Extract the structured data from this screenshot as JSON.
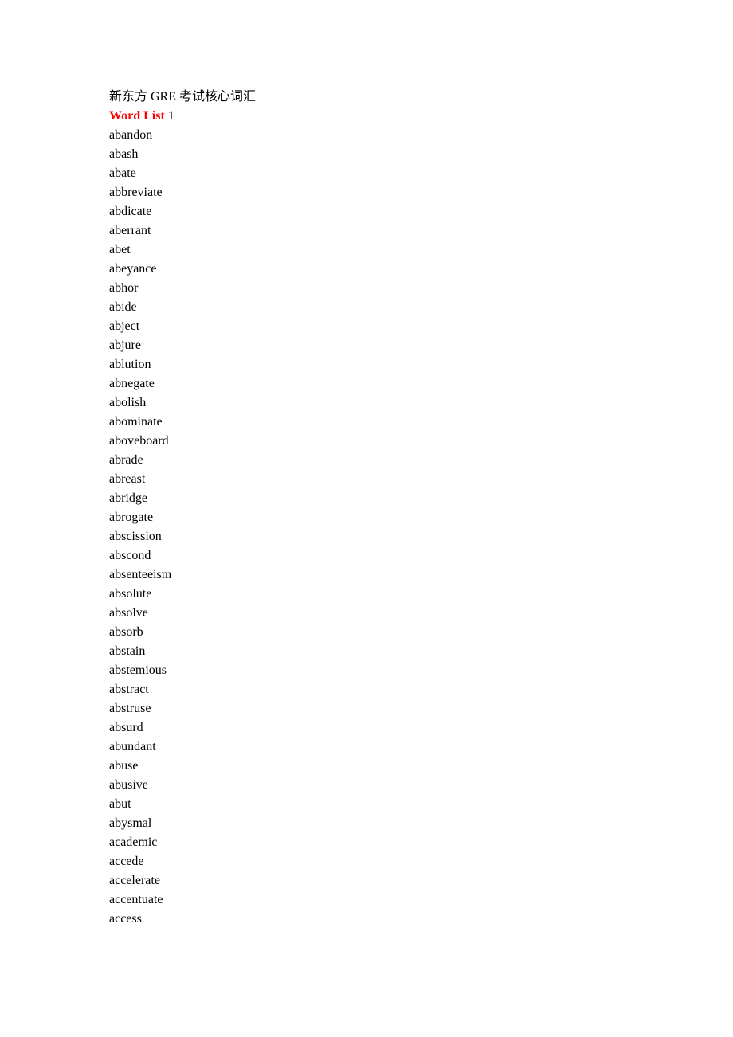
{
  "document": {
    "title": "新东方 GRE 考试核心词汇",
    "heading": {
      "label": "Word List",
      "number": "1",
      "label_color": "#FF0000",
      "number_color": "#000000"
    },
    "page_background": "#FFFFFF",
    "text_color": "#000000",
    "words": [
      "abandon",
      "abash",
      "abate",
      "abbreviate",
      "abdicate",
      "aberrant",
      "abet",
      "abeyance",
      "abhor",
      "abide",
      "abject",
      "abjure",
      "ablution",
      "abnegate",
      "abolish",
      "abominate",
      "aboveboard",
      "abrade",
      "abreast",
      "abridge",
      "abrogate",
      "abscission",
      "abscond",
      "absenteeism",
      "absolute",
      "absolve",
      "absorb",
      "abstain",
      "abstemious",
      "abstract",
      "abstruse",
      "absurd",
      "abundant",
      "abuse",
      "abusive",
      "abut",
      "abysmal",
      "academic",
      "accede",
      "accelerate",
      "accentuate",
      "access"
    ]
  }
}
